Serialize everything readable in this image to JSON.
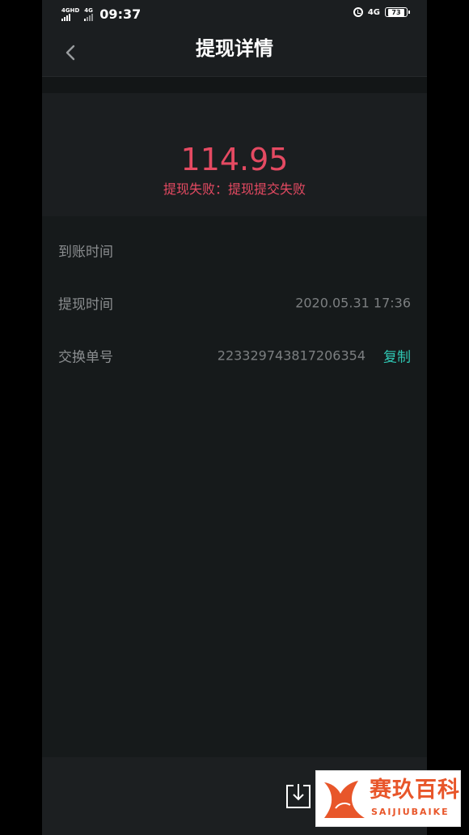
{
  "status_bar": {
    "net_left_1": "4G",
    "net_left_1_sup": "HD",
    "net_left_2": "4G",
    "time": "09:37",
    "net_right": "4G",
    "battery": "73"
  },
  "header": {
    "title": "提现详情"
  },
  "summary": {
    "amount": "114.95",
    "status": "提现失败：提现提交失败"
  },
  "details": [
    {
      "label": "到账时间",
      "value": ""
    },
    {
      "label": "提现时间",
      "value": "2020.05.31 17:36"
    },
    {
      "label": "交换单号",
      "value": "223329743817206354",
      "action": "复制"
    }
  ],
  "watermark": {
    "brand_cn": "赛玖百科",
    "brand_en": "SAIJIUBAIKE"
  },
  "colors": {
    "accent_red": "#e54a62",
    "accent_teal": "#2fc6b2",
    "brand_orange": "#e8562a"
  },
  "icons": [
    "back-arrow-icon",
    "alarm-icon",
    "battery-icon",
    "download-icon",
    "whale-logo-icon"
  ]
}
